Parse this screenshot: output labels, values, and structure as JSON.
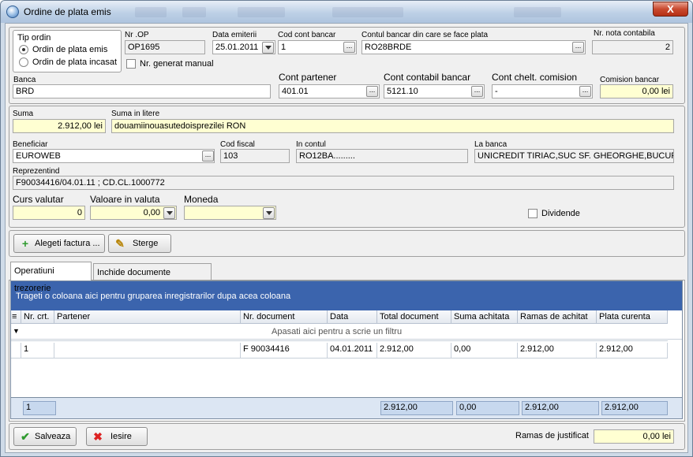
{
  "window": {
    "title": "Ordine de plata emis",
    "close_label": "X"
  },
  "tip_ordin": {
    "label": "Tip ordin",
    "options": [
      "Ordin de plata emis",
      "Ordin de plata incasat"
    ],
    "selected": 0
  },
  "nr_op": {
    "label": "Nr .OP",
    "value": "OP1695"
  },
  "data_emiterii": {
    "label": "Data emiterii",
    "value": "25.01.2011"
  },
  "cod_cont_bancar": {
    "label": "Cod cont bancar",
    "value": "1"
  },
  "contul_bancar": {
    "label": "Contul  bancar din care se face plata",
    "value": "RO28BRDE"
  },
  "nr_nota": {
    "label": "Nr. nota contabila",
    "value": "2"
  },
  "nr_generat_manual": {
    "label": "Nr. generat manual",
    "checked": false
  },
  "banca": {
    "label": "Banca",
    "value": "BRD"
  },
  "cont_partener": {
    "label": "Cont partener",
    "value": "401.01"
  },
  "cont_contabil_bancar": {
    "label": "Cont contabil bancar",
    "value": "5121.10"
  },
  "cont_chelt_comision": {
    "label": "Cont chelt. comision",
    "value": "-"
  },
  "comision_bancar": {
    "label": "Comision bancar",
    "value": "0,00 lei"
  },
  "suma": {
    "label": "Suma",
    "value": "2.912,00 lei"
  },
  "suma_litere": {
    "label": "Suma in litere",
    "value": "douamiinouasutedoisprezilei RON"
  },
  "beneficiar": {
    "label": "Beneficiar",
    "value": "EUROWEB"
  },
  "cod_fiscal": {
    "label": "Cod fiscal",
    "value": "103"
  },
  "in_contul": {
    "label": "In contul",
    "value": "RO12BA........."
  },
  "la_banca": {
    "label": "La banca",
    "value": "UNICREDIT TIRIAC,SUC SF. GHEORGHE,BUCURE"
  },
  "reprezentind": {
    "label": "Reprezentind",
    "value": "F90034416/04.01.11 ; CD.CL.1000772"
  },
  "curs_valutar": {
    "label": "Curs valutar",
    "value": "0"
  },
  "valoare_valuta": {
    "label": "Valoare in valuta",
    "value": "0,00"
  },
  "moneda": {
    "label": "Moneda",
    "value": ""
  },
  "dividende": {
    "label": "Dividende",
    "checked": false
  },
  "buttons": {
    "alegeti": "Alegeti factura ...",
    "sterge": "Sterge",
    "salveaza": "Salveaza",
    "iesire": "Iesire"
  },
  "tabs": [
    "Operatiuni trezorerie",
    "Inchide documente planificate"
  ],
  "grid": {
    "group_hint": "Trageti o coloana aici pentru gruparea inregistrarilor dupa acea coloana",
    "filter_hint": "Apasati aici pentru a scrie un filtru",
    "columns": [
      "Nr. crt.",
      "Partener",
      "Nr. document",
      "Data",
      "Total document",
      "Suma achitata",
      "Ramas de achitat",
      "Plata curenta"
    ],
    "rows": [
      [
        "1",
        "",
        "F 90034416",
        "04.01.2011",
        "2.912,00",
        "0,00",
        "2.912,00",
        "2.912,00"
      ]
    ],
    "footer": {
      "count": "1",
      "total": "2.912,00",
      "achitata": "0,00",
      "ramas": "2.912,00",
      "plata": "2.912,00"
    }
  },
  "ramas_justificat": {
    "label": "Ramas de justificat",
    "value": "0,00 lei"
  }
}
